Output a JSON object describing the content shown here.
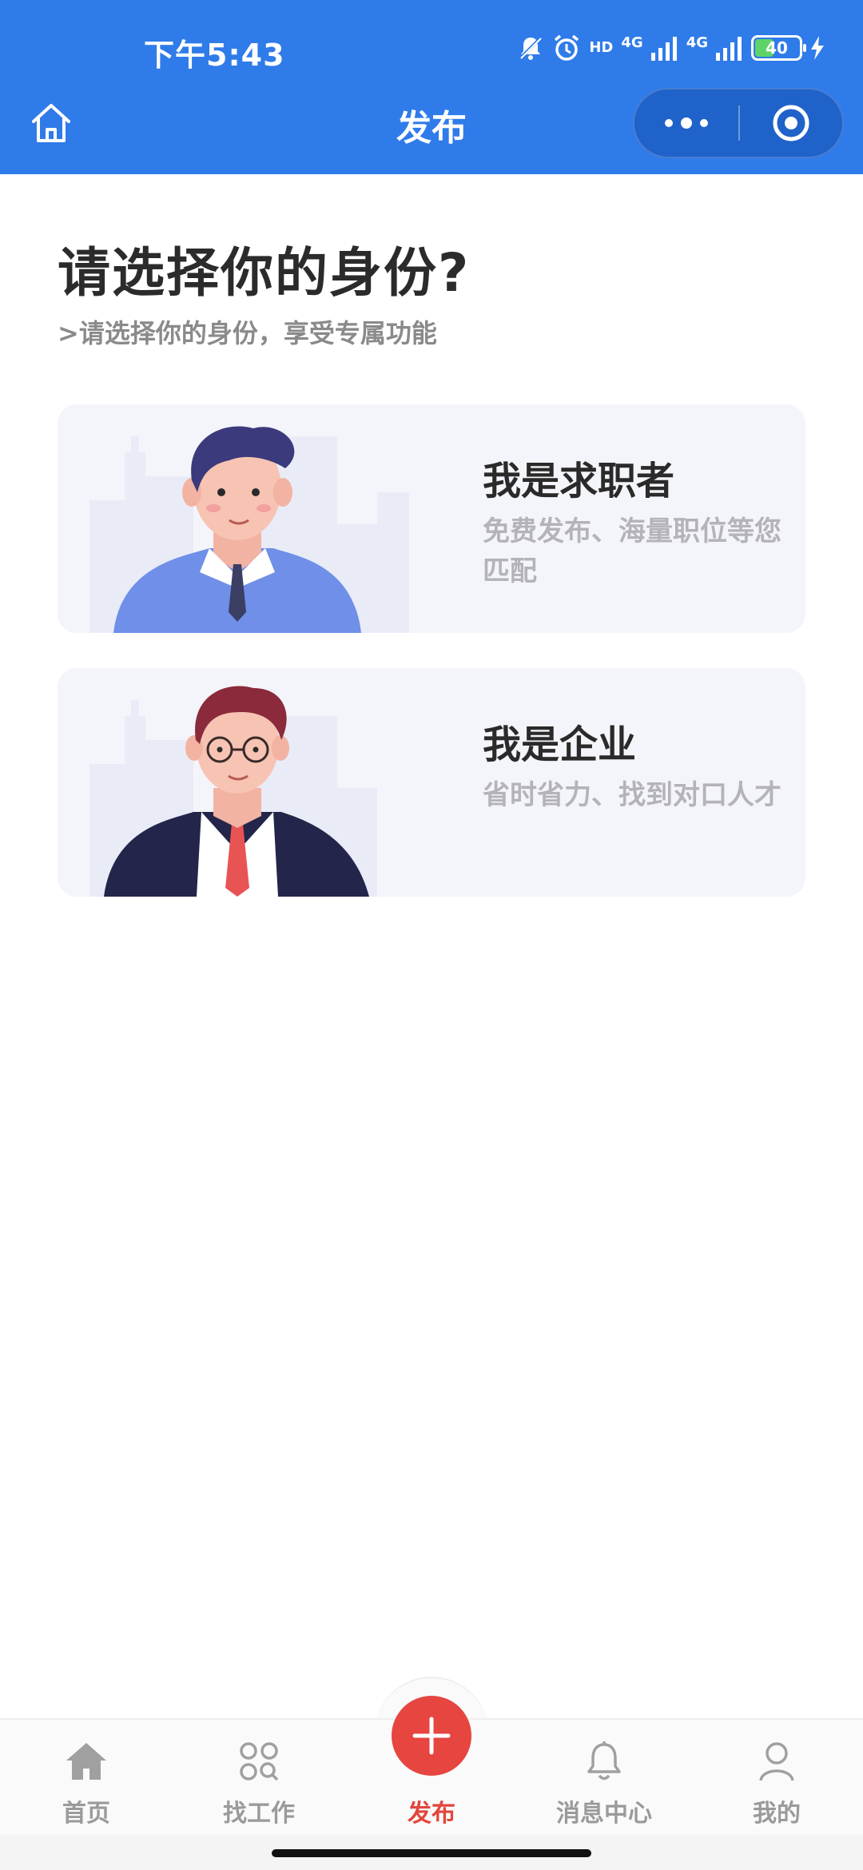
{
  "status_bar": {
    "time": "下午5:43",
    "network_1": "4G",
    "network_2": "4G",
    "hd_label": "HD",
    "battery_level": "40",
    "battery_fraction": 0.4
  },
  "nav": {
    "title": "发布",
    "home_icon": "home-outline-icon",
    "more_icon": "more-dots-icon",
    "close_icon": "target-close-icon"
  },
  "content": {
    "title": "请选择你的身份?",
    "subtitle": ">请选择你的身份，享受专属功能",
    "cards": [
      {
        "title": "我是求职者",
        "description": "免费发布、海量职位等您匹配",
        "illustration": "job-seeker-avatar"
      },
      {
        "title": "我是企业",
        "description": "省时省力、找到对口人才",
        "illustration": "business-person-avatar"
      }
    ]
  },
  "tabbar": {
    "tabs": [
      {
        "label": "首页",
        "icon": "home-icon"
      },
      {
        "label": "找工作",
        "icon": "grid-search-icon"
      },
      {
        "label": "发布",
        "icon": "plus-icon"
      },
      {
        "label": "消息中心",
        "icon": "bell-icon"
      },
      {
        "label": "我的",
        "icon": "user-icon"
      }
    ],
    "active_index": 2
  },
  "colors": {
    "primary_blue": "#2f7be9",
    "accent_red": "#e64540",
    "card_bg": "#f4f5fa",
    "inactive_tab": "#9a9a9a"
  }
}
